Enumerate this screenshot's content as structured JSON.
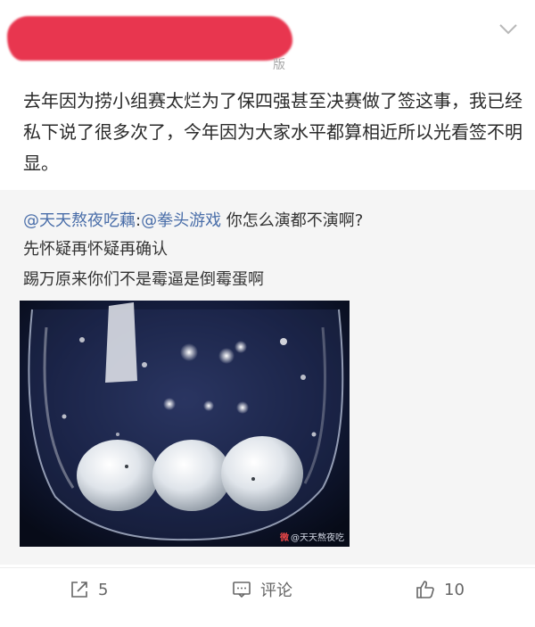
{
  "post": {
    "meta_suffix": "版",
    "text": "去年因为捞小组赛太烂为了保四强甚至决赛做了签这事，我已经私下说了很多次了，今年因为大家水平都算相近所以光看签不明显。"
  },
  "retweet": {
    "mention_1": "@天天熬夜吃藕",
    "separator": ":",
    "mention_2": "@拳头游戏",
    "line1_text": " 你怎么演都不演啊?",
    "line2": "先怀疑再怀疑再确认",
    "line3": "踢万原来你们不是霉逼是倒霉蛋啊",
    "image": {
      "watermark_logo": "微",
      "watermark_text": "@天天熬夜吃"
    }
  },
  "actions": {
    "share_icon": "share-icon",
    "share_count": "5",
    "comment_icon": "comment-icon",
    "comment_label": "评论",
    "like_icon": "thumbs-up-icon",
    "like_count": "10"
  },
  "colors": {
    "redaction": "#e8364f",
    "mention": "#4a6ea9",
    "retweet_bg": "#f5f5f5"
  }
}
